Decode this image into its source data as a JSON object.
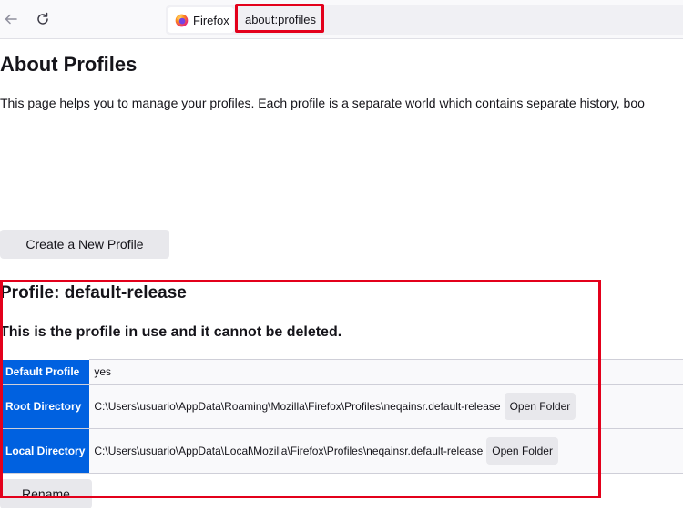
{
  "browser": {
    "tab_label": "Firefox",
    "url": "about:profiles",
    "icons": [
      "back-arrow-icon",
      "reload-icon",
      "firefox-logo-icon"
    ]
  },
  "page": {
    "title": "About Profiles",
    "description": "This page helps you to manage your profiles. Each profile is a separate world which contains separate history, boo",
    "create_button": "Create a New Profile"
  },
  "profile": {
    "title": "Profile: default-release",
    "note": "This is the profile in use and it cannot be deleted.",
    "rows": [
      {
        "label": "Default Profile",
        "value": "yes"
      },
      {
        "label": "Root Directory",
        "value": "C:\\Users\\usuario\\AppData\\Roaming\\Mozilla\\Firefox\\Profiles\\neqainsr.default-release",
        "button": "Open Folder"
      },
      {
        "label": "Local Directory",
        "value": "C:\\Users\\usuario\\AppData\\Local\\Mozilla\\Firefox\\Profiles\\neqainsr.default-release",
        "button": "Open Folder"
      }
    ],
    "rename_button": "Rename"
  },
  "colors": {
    "accent": "#0061e0",
    "highlight": "#e3001b"
  }
}
